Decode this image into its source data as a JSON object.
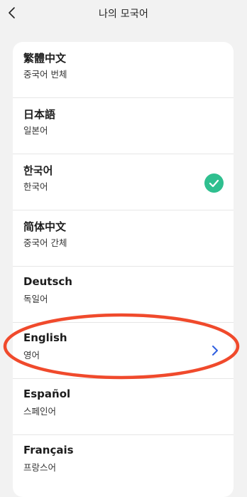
{
  "header": {
    "title": "나의 모국어",
    "back_icon": "chevron-left-icon"
  },
  "languages": [
    {
      "native": "繁體中文",
      "local": "중국어 번체"
    },
    {
      "native": "日本語",
      "local": "일본어"
    },
    {
      "native": "한국어",
      "local": "한국어"
    },
    {
      "native": "简体中文",
      "local": "중국어 간체"
    },
    {
      "native": "Deutsch",
      "local": "독일어"
    },
    {
      "native": "English",
      "local": "영어"
    },
    {
      "native": "Español",
      "local": "스페인어"
    },
    {
      "native": "Français",
      "local": "프랑스어"
    }
  ],
  "selected_language": "한국어",
  "colors": {
    "check": "#2fbf8f",
    "chevron": "#2f5fe0",
    "highlight": "#f04a2c"
  }
}
